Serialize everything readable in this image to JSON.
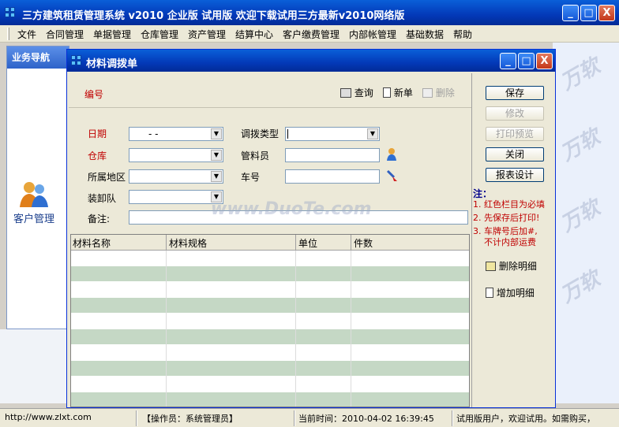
{
  "window": {
    "title": "三方建筑租赁管理系统   v2010  企业版    试用版   欢迎下载试用三方最新v2010网络版",
    "controls": [
      "_",
      "□",
      "X"
    ]
  },
  "menu": [
    "文件",
    "合同管理",
    "单据管理",
    "仓库管理",
    "资产管理",
    "结算中心",
    "客户缴费管理",
    "内部帐管理",
    "基础数据",
    "帮助"
  ],
  "background": {
    "left_panel_title": "业务导航",
    "left_panel_item": "客户管理"
  },
  "dialog": {
    "title": "材料调拨单",
    "controls": [
      "_",
      "□",
      "X"
    ],
    "field_code_label": "编号",
    "toolbar": {
      "query": "查询",
      "new": "新单",
      "delete": "删除"
    },
    "fields": {
      "date_label": "日期",
      "date_value": "-   -",
      "warehouse_label": "仓库",
      "region_label": "所属地区",
      "loader_label": "装卸队",
      "remark_label": "备注:",
      "transfer_type_label": "调拨类型",
      "keeper_label": "管料员",
      "car_label": "车号"
    },
    "buttons": {
      "save": "保存",
      "modify": "修改",
      "print_preview": "打印预览",
      "close": "关闭",
      "report_design": "报表设计",
      "delete_detail": "删除明细",
      "add_detail": "增加明细"
    },
    "notes": {
      "title": "注：",
      "items": [
        "1. 红色栏目为必填",
        "2. 先保存后打印!",
        "3. 车牌号后加#,",
        "不计内部运费"
      ]
    },
    "grid": {
      "columns": [
        "材料名称",
        "材料规格",
        "单位",
        "件数"
      ],
      "rows": 10
    }
  },
  "statusbar": {
    "url": "http://www.zlxt.com",
    "operator": "【操作员：系统管理员】",
    "time": "当前时间：2010-04-02   16:39:45",
    "message": "试用版用户，欢迎试用。如需购买，"
  },
  "watermark": "www.DuoTe.com",
  "colors": {
    "titlebar": "#0339b8",
    "required_label": "#c00000",
    "grid_alt_row": "#c5d8c5"
  }
}
